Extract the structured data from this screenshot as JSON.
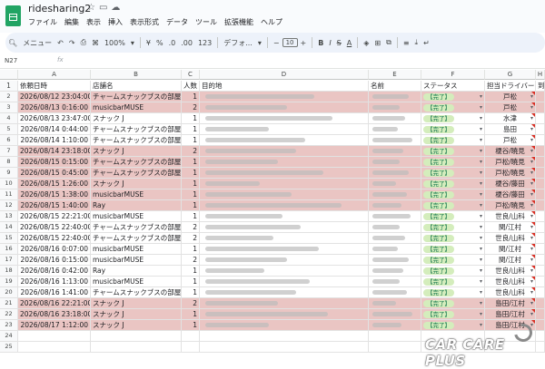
{
  "app": {
    "doc_title": "ridesharing2",
    "menu": [
      "ファイル",
      "編集",
      "表示",
      "挿入",
      "表示形式",
      "データ",
      "ツール",
      "拡張機能",
      "ヘルプ"
    ]
  },
  "toolbar": {
    "search_label": "メニュー",
    "zoom": "100%",
    "currency": "¥",
    "percent": "%",
    "dec_minus": ".0",
    "dec_plus": ".00",
    "number_fmt": "123",
    "font": "デフォ...",
    "font_size": "10"
  },
  "formula": {
    "cell_ref": "N27",
    "fx": "fx"
  },
  "columns": [
    "A",
    "B",
    "C",
    "D",
    "E",
    "F",
    "G",
    "H"
  ],
  "header": {
    "row_num": "1",
    "a": "依頼日時",
    "b": "店舗名",
    "c": "人数",
    "d": "目的地",
    "e": "名前",
    "f": "ステータス",
    "g": "担当ドライバー",
    "h": "到"
  },
  "rows": [
    {
      "n": "2",
      "a": "2026/08/12 23:04:00",
      "b": "チャームスナックブスの部屋",
      "c": "1",
      "f": "【完了】",
      "g": "戸松",
      "hl": true
    },
    {
      "n": "3",
      "a": "2026/08/13 0:16:00",
      "b": "musicbarMUSE",
      "c": "2",
      "f": "【完了】",
      "g": "戸松",
      "hl": true
    },
    {
      "n": "4",
      "a": "2026/08/13 23:47:00",
      "b": "スナック J",
      "c": "1",
      "f": "【完了】",
      "g": "水津",
      "hl": false
    },
    {
      "n": "5",
      "a": "2026/08/14 0:44:00",
      "b": "チャームスナックブスの部屋",
      "c": "1",
      "f": "【完了】",
      "g": "島田",
      "hl": false
    },
    {
      "n": "6",
      "a": "2026/08/14 1:10:00",
      "b": "チャームスナックブスの部屋",
      "c": "1",
      "f": "【完了】",
      "g": "戸松",
      "hl": false
    },
    {
      "n": "7",
      "a": "2026/08/14 23:18:00",
      "b": "スナック J",
      "c": "2",
      "f": "【完了】",
      "g": "榎谷/曉見",
      "hl": true
    },
    {
      "n": "8",
      "a": "2026/08/15 0:15:00",
      "b": "チャームスナックブスの部屋",
      "c": "1",
      "f": "【完了】",
      "g": "戸松/曉見",
      "hl": true
    },
    {
      "n": "9",
      "a": "2026/08/15 0:45:00",
      "b": "チャームスナックブスの部屋",
      "c": "1",
      "f": "【完了】",
      "g": "戸松/曉見",
      "hl": true
    },
    {
      "n": "10",
      "a": "2026/08/15 1:26:00",
      "b": "スナック J",
      "c": "1",
      "f": "【完了】",
      "g": "榎谷/藤田",
      "hl": true
    },
    {
      "n": "11",
      "a": "2026/08/15 1:38:00",
      "b": "musicbarMUSE",
      "c": "1",
      "f": "【完了】",
      "g": "榎谷/藤田",
      "hl": true
    },
    {
      "n": "12",
      "a": "2026/08/15 1:40:00",
      "b": "Ray",
      "c": "1",
      "f": "【完了】",
      "g": "戸松/曉見",
      "hl": true
    },
    {
      "n": "13",
      "a": "2026/08/15 22:21:00",
      "b": "musicbarMUSE",
      "c": "1",
      "f": "【完了】",
      "g": "世良/山科",
      "hl": false
    },
    {
      "n": "14",
      "a": "2026/08/15 22:40:00",
      "b": "チャームスナックブスの部屋",
      "c": "2",
      "f": "【完了】",
      "g": "関/江村",
      "hl": false
    },
    {
      "n": "15",
      "a": "2026/08/15 22:40:00",
      "b": "チャームスナックブスの部屋",
      "c": "2",
      "f": "【完了】",
      "g": "世良/山科",
      "hl": false
    },
    {
      "n": "16",
      "a": "2026/08/16 0:07:00",
      "b": "musicbarMUSE",
      "c": "1",
      "f": "【完了】",
      "g": "関/江村",
      "hl": false
    },
    {
      "n": "17",
      "a": "2026/08/16 0:15:00",
      "b": "musicbarMUSE",
      "c": "2",
      "f": "【完了】",
      "g": "関/江村",
      "hl": false
    },
    {
      "n": "18",
      "a": "2026/08/16 0:42:00",
      "b": "Ray",
      "c": "1",
      "f": "【完了】",
      "g": "世良/山科",
      "hl": false
    },
    {
      "n": "19",
      "a": "2026/08/16 1:13:00",
      "b": "musicbarMUSE",
      "c": "1",
      "f": "【完了】",
      "g": "世良/山科",
      "hl": false
    },
    {
      "n": "20",
      "a": "2026/08/16 1:41:00",
      "b": "チャームスナックブスの部屋",
      "c": "1",
      "f": "【完了】",
      "g": "世良/山科",
      "hl": false
    },
    {
      "n": "21",
      "a": "2026/08/16 22:21:00",
      "b": "スナック J",
      "c": "2",
      "f": "【完了】",
      "g": "島田/江村",
      "hl": true
    },
    {
      "n": "22",
      "a": "2026/08/16 23:18:00",
      "b": "スナック J",
      "c": "1",
      "f": "【完了】",
      "g": "島田/江村",
      "hl": true
    },
    {
      "n": "23",
      "a": "2026/08/17 1:12:00",
      "b": "スナック J",
      "c": "1",
      "f": "【完了】",
      "g": "島田/江村",
      "hl": true
    },
    {
      "n": "24",
      "a": "",
      "b": "",
      "c": "",
      "f": "",
      "g": "",
      "hl": false
    },
    {
      "n": "25",
      "a": "",
      "b": "",
      "c": "",
      "f": "",
      "g": "",
      "hl": false
    }
  ],
  "watermark": "CAR CARE PLUS",
  "colors": {
    "highlight": "#eac5c3",
    "chip_bg": "#d4edbc",
    "chip_text": "#11734b",
    "sheets_green": "#21a464"
  }
}
